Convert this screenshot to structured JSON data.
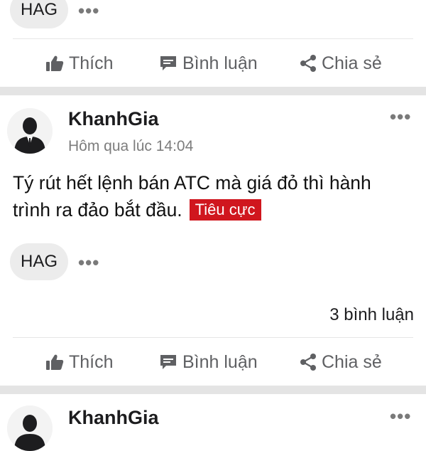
{
  "top_post": {
    "tag": "HAG",
    "more_icon": "ellipsis-icon"
  },
  "actions": {
    "like_label": "Thích",
    "comment_label": "Bình luận",
    "share_label": "Chia sẻ",
    "like_icon": "thumbs-up-icon",
    "comment_icon": "chat-bubble-icon",
    "share_icon": "share-icon"
  },
  "post": {
    "author": "KhanhGia",
    "timestamp": "Hôm qua lúc 14:04",
    "text": "Tý rút hết lệnh bán ATC mà giá đỏ thì hành trình ra đảo bắt đầu.",
    "sentiment_label": "Tiêu cực",
    "sentiment_color": "#d0161e",
    "tag": "HAG",
    "comment_count": "3 bình luận"
  },
  "next_post": {
    "author": "KhanhGia"
  }
}
